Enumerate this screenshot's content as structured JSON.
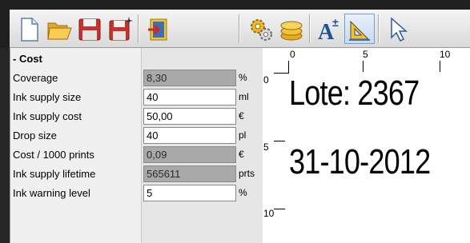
{
  "toolbar": {
    "buttons": [
      {
        "name": "new-file",
        "icon": "new-document-icon"
      },
      {
        "name": "open-file",
        "icon": "open-folder-icon"
      },
      {
        "name": "save-file",
        "icon": "save-disk-icon"
      },
      {
        "name": "save-as",
        "icon": "save-as-disk-icon"
      },
      {
        "name": "exit",
        "icon": "exit-door-icon"
      },
      {
        "name": "settings",
        "icon": "gears-icon"
      },
      {
        "name": "cost",
        "icon": "coins-icon"
      },
      {
        "name": "add-text",
        "icon": "add-text-icon"
      },
      {
        "name": "ruler",
        "icon": "ruler-icon"
      },
      {
        "name": "select",
        "icon": "pointer-icon"
      }
    ]
  },
  "properties": {
    "group_label": "- Cost",
    "rows": [
      {
        "label": "Coverage",
        "value": "8,30",
        "unit": "%",
        "readonly": true
      },
      {
        "label": "Ink supply size",
        "value": "40",
        "unit": "ml",
        "readonly": false
      },
      {
        "label": "Ink supply cost",
        "value": "50,00",
        "unit": "€",
        "readonly": false
      },
      {
        "label": "Drop size",
        "value": "40",
        "unit": "pl",
        "readonly": false
      },
      {
        "label": "Cost / 1000 prints",
        "value": "0,09",
        "unit": "€",
        "readonly": true
      },
      {
        "label": "Ink supply lifetime",
        "value": "565611",
        "unit": "prts",
        "readonly": true
      },
      {
        "label": "Ink warning level",
        "value": "5",
        "unit": "%",
        "readonly": false
      }
    ]
  },
  "preview": {
    "ruler_top": [
      "0",
      "5",
      "10"
    ],
    "ruler_left": [
      "0",
      "5",
      "10"
    ],
    "line1": "Lote: 2367",
    "line2": "31-10-2012"
  },
  "colors": {
    "readonly_field": "#a9a9a9",
    "selected_button": "#c8daf0"
  }
}
